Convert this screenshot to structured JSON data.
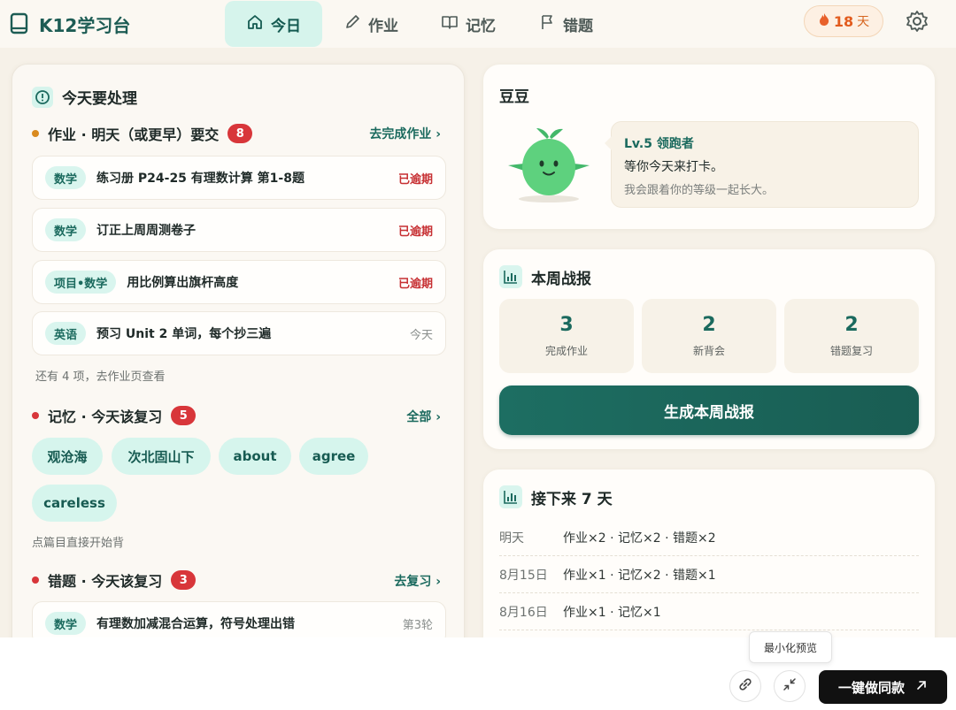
{
  "app": {
    "name": "K12学习台"
  },
  "nav": {
    "tabs": [
      {
        "label": "今日",
        "icon": "home-icon",
        "active": true
      },
      {
        "label": "作业",
        "icon": "pencil-icon",
        "active": false
      },
      {
        "label": "记忆",
        "icon": "book-open-icon",
        "active": false
      },
      {
        "label": "错题",
        "icon": "flag-icon",
        "active": false
      }
    ]
  },
  "streak": {
    "value": "18",
    "unit": "天",
    "icon": "fire-icon"
  },
  "today": {
    "title": "今天要处理",
    "homework": {
      "title": "作业 · 明天（或更早）要交",
      "count": "8",
      "link": "去完成作业 ›",
      "dot_color": "#d98a1e",
      "items": [
        {
          "tag": "数学",
          "title": "练习册 P24-25 有理数计算 第1-8题",
          "status": "已逾期",
          "overdue": true
        },
        {
          "tag": "数学",
          "title": "订正上周周测卷子",
          "status": "已逾期",
          "overdue": true
        },
        {
          "tag": "项目•数学",
          "title": "用比例算出旗杆高度",
          "status": "已逾期",
          "overdue": true
        },
        {
          "tag": "英语",
          "title": "预习 Unit 2 单词，每个抄三遍",
          "status": "今天",
          "overdue": false
        }
      ],
      "more_note": "还有 4 项，去作业页查看"
    },
    "memory": {
      "title": "记忆 · 今天该复习",
      "count": "5",
      "link": "全部 ›",
      "dot_color": "#d8363a",
      "chips": [
        "观沧海",
        "次北固山下",
        "about",
        "agree",
        "careless"
      ],
      "note": "点篇目直接开始背"
    },
    "mistakes": {
      "title": "错题 · 今天该复习",
      "count": "3",
      "link": "去复习 ›",
      "dot_color": "#d8363a",
      "items": [
        {
          "tag": "数学",
          "title": "有理数加减混合运算，符号处理出错",
          "status": "第3轮"
        }
      ]
    }
  },
  "pet": {
    "name": "豆豆",
    "level": "Lv.5 领跑者",
    "line1": "等你今天来打卡。",
    "line2": "我会跟着你的等级一起长大。"
  },
  "weekly": {
    "title": "本周战报",
    "stats": [
      {
        "value": "3",
        "label": "完成作业"
      },
      {
        "value": "2",
        "label": "新背会"
      },
      {
        "value": "2",
        "label": "错题复习"
      }
    ],
    "button": "生成本周战报"
  },
  "next7": {
    "title": "接下来 7 天",
    "rows": [
      {
        "date": "明天",
        "desc": "作业×2 · 记忆×2 · 错题×2"
      },
      {
        "date": "8月15日",
        "desc": "作业×1 · 记忆×2 · 错题×1"
      },
      {
        "date": "8月16日",
        "desc": "作业×1 · 记忆×1"
      }
    ]
  },
  "footer": {
    "tooltip": "最小化预览",
    "clone_button": "一键做同款"
  },
  "colors": {
    "accent": "#1b6a5e",
    "overdue": "#c73033",
    "badge": "#d8363a",
    "streak": "#e25b1d"
  }
}
